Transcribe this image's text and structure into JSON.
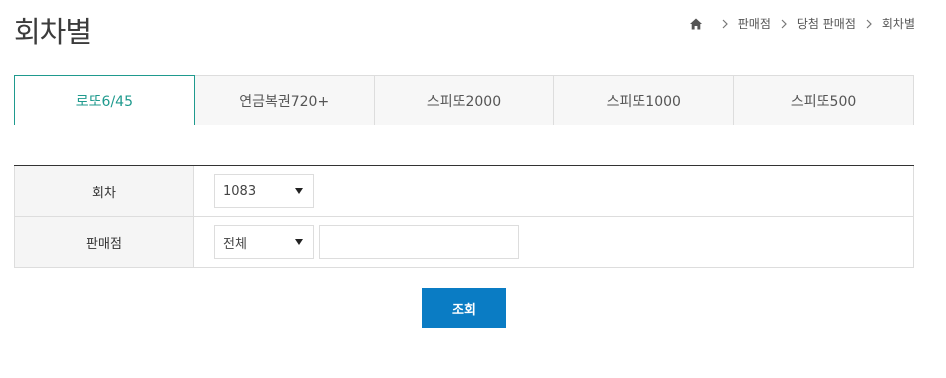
{
  "page": {
    "title": "회차별"
  },
  "breadcrumb": {
    "home_icon": "home-icon",
    "items": [
      "판매점",
      "당첨 판매점",
      "회차별"
    ]
  },
  "tabs": [
    {
      "label": "로또6/45",
      "active": true
    },
    {
      "label": "연금복권720+",
      "active": false
    },
    {
      "label": "스피또2000",
      "active": false
    },
    {
      "label": "스피또1000",
      "active": false
    },
    {
      "label": "스피또500",
      "active": false
    }
  ],
  "form": {
    "round": {
      "label": "회차",
      "selected": "1083"
    },
    "store": {
      "label": "판매점",
      "selected": "전체",
      "input_value": ""
    }
  },
  "search_button": {
    "label": "조회"
  },
  "colors": {
    "accent": "#1f9a8e",
    "button": "#0a7cc4",
    "header_bg": "#f5f5f5",
    "border": "#dddddd"
  }
}
